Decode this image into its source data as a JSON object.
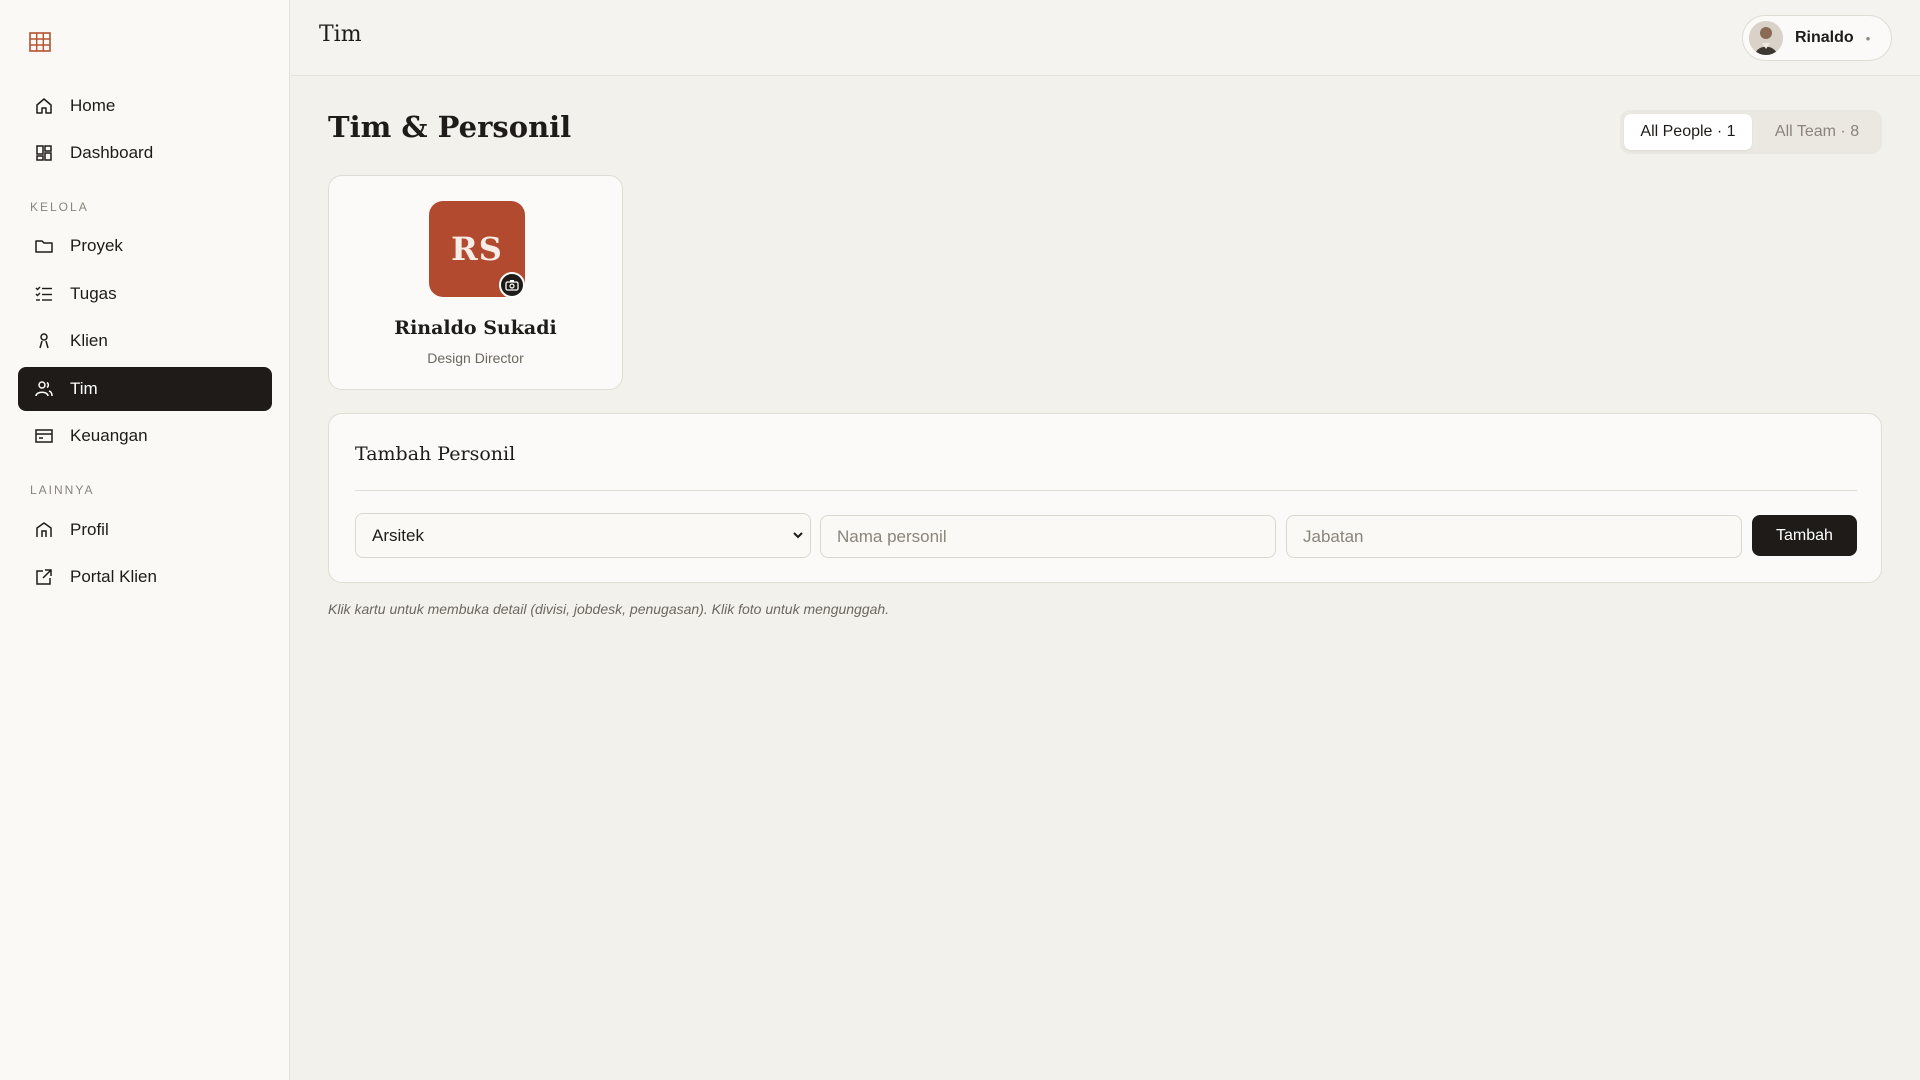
{
  "sidebar": {
    "primary": [
      {
        "label": "Home",
        "icon": "home-icon"
      },
      {
        "label": "Dashboard",
        "icon": "dashboard-icon"
      }
    ],
    "section_kelola": "KELOLA",
    "kelola": [
      {
        "label": "Proyek",
        "icon": "folder-icon"
      },
      {
        "label": "Tugas",
        "icon": "checklist-icon"
      },
      {
        "label": "Klien",
        "icon": "person-icon"
      },
      {
        "label": "Tim",
        "icon": "team-icon",
        "active": true
      },
      {
        "label": "Keuangan",
        "icon": "card-icon"
      }
    ],
    "section_lainnya": "LAINNYA",
    "lainnya": [
      {
        "label": "Profil",
        "icon": "building-icon"
      },
      {
        "label": "Portal Klien",
        "icon": "external-link-icon"
      }
    ]
  },
  "topbar": {
    "title": "Tim",
    "user_name": "Rinaldo"
  },
  "page": {
    "title": "Tim & Personil",
    "tabs": [
      {
        "label": "All People · 1",
        "active": true
      },
      {
        "label": "All Team · 8",
        "active": false
      }
    ]
  },
  "people": [
    {
      "initials": "RS",
      "name": "Rinaldo Sukadi",
      "role": "Design Director"
    }
  ],
  "add_form": {
    "title": "Tambah Personil",
    "division_selected": "Arsitek",
    "name_placeholder": "Nama personil",
    "position_placeholder": "Jabatan",
    "submit_label": "Tambah"
  },
  "hint": "Klik kartu untuk membuka detail (divisi, jobdesk, penugasan). Klik foto untuk mengunggah.",
  "colors": {
    "accent": "#b24a30",
    "dark": "#1e1b18",
    "background": "#f3f1ec"
  }
}
